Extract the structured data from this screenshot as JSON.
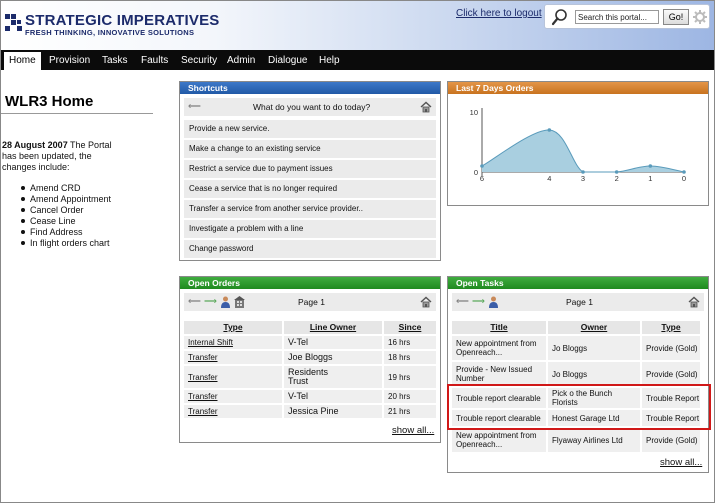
{
  "header": {
    "logo_title": "STRATEGIC IMPERATIVES",
    "logo_tagline": "FRESH THINKING, INNOVATIVE SOLUTIONS",
    "logout_link": "Click here to logout",
    "search_placeholder": "Search this portal...",
    "go_label": "Go!"
  },
  "nav": {
    "items": [
      {
        "label": "Home"
      },
      {
        "label": "Provision"
      },
      {
        "label": "Tasks"
      },
      {
        "label": "Faults"
      },
      {
        "label": "Security"
      },
      {
        "label": "Admin"
      },
      {
        "label": "Dialogue"
      },
      {
        "label": "Help"
      }
    ]
  },
  "left": {
    "title": "WLR3 Home",
    "intro_date": "28 August 2007",
    "intro_rest": "The Portal has been updated, the changes include:",
    "bullets": [
      "Amend CRD",
      "Amend Appointment",
      "Cancel Order",
      "Cease Line",
      "Find Address",
      "In flight orders chart"
    ]
  },
  "shortcuts": {
    "title": "Shortcuts",
    "prompt": "What do you want to do today?",
    "items": [
      "Provide a new service.",
      "Make a change to an existing service",
      "Restrict a service due to payment issues",
      "Cease a service that is no longer required",
      "Transfer a service from another service provider..",
      "Investigate a problem with a line",
      "Change password"
    ]
  },
  "orders_chart": {
    "title": "Last 7 Days Orders"
  },
  "chart_data": {
    "type": "area",
    "title": "Last 7 Days Orders",
    "x": [
      "6",
      "4",
      "3",
      "2",
      "1",
      "0"
    ],
    "x_values": [
      6,
      4,
      3,
      2,
      1,
      0
    ],
    "y_ticks": [
      "10",
      "0"
    ],
    "ylim": [
      0,
      10
    ],
    "points": [
      {
        "x": 6,
        "y": 1
      },
      {
        "x": 4,
        "y": 7
      },
      {
        "x": 3,
        "y": 0
      },
      {
        "x": 2,
        "y": 0
      },
      {
        "x": 1,
        "y": 1
      },
      {
        "x": 0,
        "y": 0
      }
    ],
    "fill_color": "#a9cfe0",
    "line_color": "#5a9bbb",
    "grid": false
  },
  "open_orders": {
    "title": "Open Orders",
    "page_label": "Page 1",
    "columns": [
      "Type",
      "Line Owner",
      "Since"
    ],
    "rows": [
      [
        "Internal Shift",
        "V-Tel",
        "16 hrs"
      ],
      [
        "Transfer",
        "Joe Bloggs",
        "18 hrs"
      ],
      [
        "Transfer",
        "Residents Trust",
        "19 hrs"
      ],
      [
        "Transfer",
        "V-Tel",
        "20 hrs"
      ],
      [
        "Transfer",
        "Jessica Pine",
        "21 hrs"
      ]
    ],
    "show_all": "show all..."
  },
  "open_tasks": {
    "title": "Open Tasks",
    "page_label": "Page 1",
    "columns": [
      "Title",
      "Owner",
      "Type"
    ],
    "rows": [
      [
        "New appointment from Openreach...",
        "Jo Bloggs",
        "Provide (Gold)"
      ],
      [
        "Provide - New Issued Number",
        "Jo Bloggs",
        "Provide (Gold)"
      ],
      [
        "Trouble report clearable",
        "Pick o the Bunch Florists",
        "Trouble Report"
      ],
      [
        "Trouble report clearable",
        "Honest Garage Ltd",
        "Trouble Report"
      ],
      [
        "New appointment from Openreach...",
        "Flyaway Airlines Ltd",
        "Provide (Gold)"
      ]
    ],
    "show_all": "show all..."
  },
  "colors": {
    "brand": "#1c2b6b",
    "nav_bg": "#0b0b0b",
    "shortcuts_head": "#2b66b4",
    "chart_head": "#d4822f",
    "green_head": "#2a962a",
    "highlight": "#d01818"
  }
}
